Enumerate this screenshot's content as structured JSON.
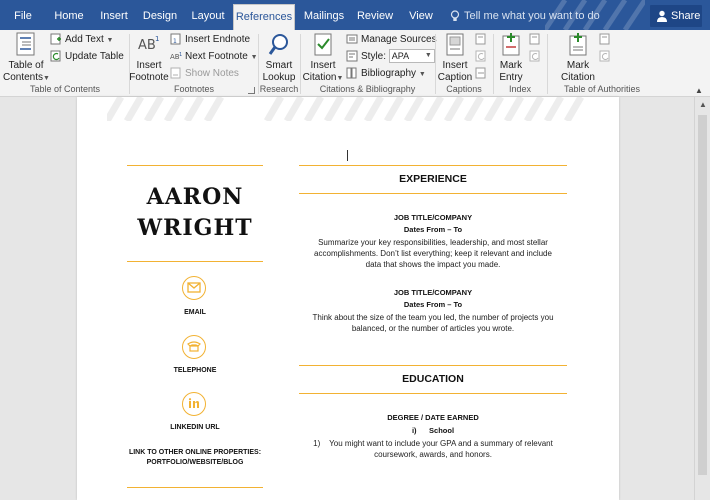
{
  "tabs": [
    {
      "label": "File",
      "active": false
    },
    {
      "label": "Home",
      "active": false
    },
    {
      "label": "Insert",
      "active": false
    },
    {
      "label": "Design",
      "active": false
    },
    {
      "label": "Layout",
      "active": false
    },
    {
      "label": "References",
      "active": true
    },
    {
      "label": "Mailings",
      "active": false
    },
    {
      "label": "Review",
      "active": false
    },
    {
      "label": "View",
      "active": false
    }
  ],
  "tell_me": "Tell me what you want to do",
  "share": "Share",
  "ribbon": {
    "toc": {
      "label1": "Table of",
      "label2": "Contents",
      "add_text": "Add Text",
      "update_table": "Update Table",
      "group": "Table of Contents"
    },
    "footnotes": {
      "label1": "Insert",
      "label2": "Footnote",
      "insert_endnote": "Insert Endnote",
      "next_footnote": "Next Footnote",
      "show_notes": "Show Notes",
      "group": "Footnotes"
    },
    "research": {
      "label1": "Smart",
      "label2": "Lookup",
      "group": "Research"
    },
    "citations": {
      "label1": "Insert",
      "label2": "Citation",
      "manage_sources": "Manage Sources",
      "style_label": "Style:",
      "style_value": "APA",
      "bibliography": "Bibliography",
      "group": "Citations & Bibliography"
    },
    "captions": {
      "label1": "Insert",
      "label2": "Caption",
      "group": "Captions"
    },
    "index": {
      "label1": "Mark",
      "label2": "Entry",
      "group": "Index"
    },
    "authorities": {
      "label1": "Mark",
      "label2": "Citation",
      "group": "Table of Authorities"
    }
  },
  "resume": {
    "name_line1": "AARON",
    "name_line2": "WRIGHT",
    "email": "EMAIL",
    "telephone": "TELEPHONE",
    "linkedin": "LINKEDIN URL",
    "other_line1": "LINK TO OTHER ONLINE PROPERTIES:",
    "other_line2": "PORTFOLIO/WEBSITE/BLOG",
    "experience_heading": "EXPERIENCE",
    "job1_title": "JOB TITLE/COMPANY",
    "job1_dates": "Dates From – To",
    "job1_desc1": "Summarize your key responsibilities, leadership, and most stellar",
    "job1_desc2": "accomplishments. Don’t list everything; keep it relevant and include",
    "job1_desc3": "data that shows the impact you made.",
    "job2_title": "JOB TITLE/COMPANY",
    "job2_dates": "Dates From – To",
    "job2_desc1": "Think about the size of the team you led, the number of projects you",
    "job2_desc2": "balanced, or the number of articles you wrote.",
    "education_heading": "EDUCATION",
    "degree": "DEGREE / DATE EARNED",
    "school": "i)      School",
    "edu_desc1": "1)    You might want to include your GPA and a summary of relevant",
    "edu_desc2": "coursework, awards, and honors."
  },
  "colors": {
    "ribbon_blue": "#2b579a",
    "accent_gold": "#f2b233"
  }
}
